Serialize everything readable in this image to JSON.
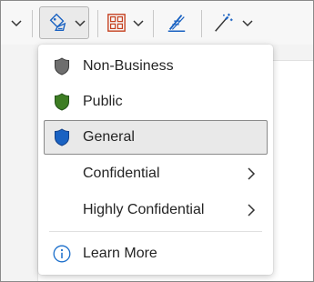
{
  "toolbar": {
    "buttons": [
      {
        "name": "left-dropdown",
        "icon": "chevron-down-icon"
      },
      {
        "name": "sensitivity",
        "icon": "sensitivity-label-icon"
      },
      {
        "name": "table",
        "icon": "table-grid-icon"
      },
      {
        "name": "editor",
        "icon": "editor-pen-icon"
      },
      {
        "name": "designer",
        "icon": "magic-wand-icon"
      }
    ]
  },
  "menu": {
    "items": [
      {
        "label": "Non-Business",
        "icon": "gray-shield-icon",
        "color": "#6e6e6e"
      },
      {
        "label": "Public",
        "icon": "green-shield-icon",
        "color": "#3d7d23"
      },
      {
        "label": "General",
        "icon": "blue-shield-icon",
        "color": "#1a62c2",
        "selected": true
      },
      {
        "label": "Confidential",
        "has_submenu": true
      },
      {
        "label": "Highly Confidential",
        "has_submenu": true
      }
    ],
    "learn_more": {
      "label": "Learn More",
      "icon": "info-icon",
      "color": "#1a6ecb"
    }
  },
  "colors": {
    "accent_blue": "#1a62c2",
    "table_red": "#c43e1c",
    "selection_bg": "#e9e9e9",
    "selection_border": "#8a8a8a"
  }
}
